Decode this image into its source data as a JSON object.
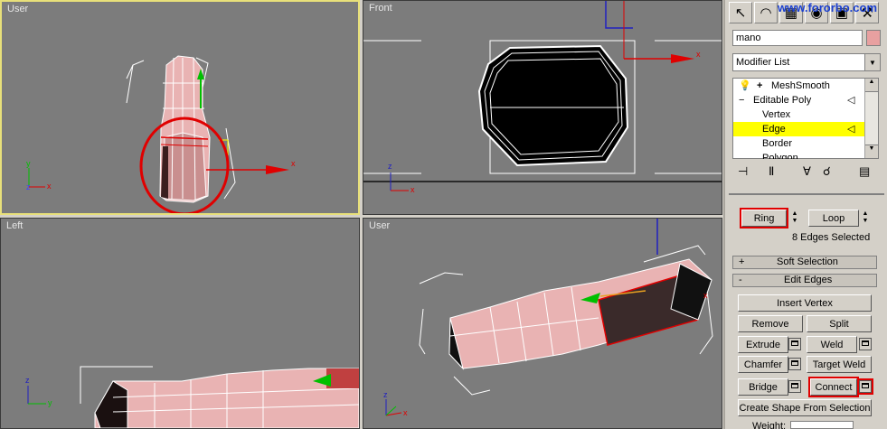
{
  "viewports": {
    "top_left": {
      "label": "User"
    },
    "top_right": {
      "label": "Front"
    },
    "bottom_left": {
      "label": "Left"
    },
    "bottom_right": {
      "label": "User"
    }
  },
  "axis": {
    "x": "x",
    "y": "y",
    "z": "z"
  },
  "panel": {
    "watermark": "www.fororbo.com",
    "object_name": "mano",
    "object_color": "#e8a0a0",
    "modifier_list": "Modifier List",
    "stack": {
      "items": [
        {
          "label": "MeshSmooth",
          "prefix": "+"
        },
        {
          "label": "Editable Poly",
          "prefix": "−"
        },
        {
          "label": "Vertex"
        },
        {
          "label": "Edge",
          "selected": true
        },
        {
          "label": "Border"
        },
        {
          "label": "Polygon"
        }
      ]
    },
    "selection": {
      "ring": "Ring",
      "loop": "Loop",
      "status": "8 Edges Selected"
    },
    "soft_selection": {
      "toggle": "+",
      "title": "Soft Selection"
    },
    "edit_edges": {
      "toggle": "-",
      "title": "Edit Edges",
      "insert_vertex": "Insert Vertex",
      "remove": "Remove",
      "split": "Split",
      "extrude": "Extrude",
      "weld": "Weld",
      "chamfer": "Chamfer",
      "target_weld": "Target Weld",
      "bridge": "Bridge",
      "connect": "Connect",
      "create_shape": "Create Shape From Selection",
      "weight": "Weight:"
    }
  },
  "colors": {
    "highlight": "#ffff00",
    "annotation": "#e00000",
    "viewport_bg": "#7c7c7c"
  }
}
